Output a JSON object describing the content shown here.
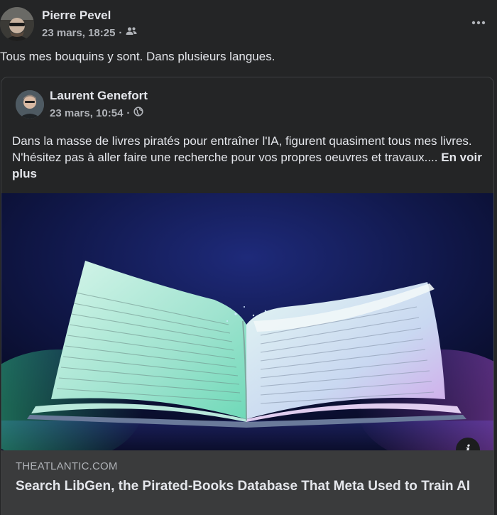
{
  "post": {
    "author": "Pierre Pevel",
    "timestamp": "23 mars, 18:25",
    "separator": "·",
    "audience_icon": "friends-icon",
    "more_icon": "more-options-icon",
    "text": "Tous mes bouquins y sont. Dans plusieurs langues."
  },
  "shared": {
    "author": "Laurent Genefort",
    "timestamp": "23 mars, 10:54",
    "separator": "·",
    "audience_icon": "globe-icon",
    "text": "Dans la masse de livres piratés pour entraîner l'IA, figurent quasiment tous mes livres. N'hésitez pas à aller faire une recherche pour vos propres oeuvres et travaux....",
    "see_more": "En voir plus"
  },
  "link": {
    "domain": "THEATLANTIC.COM",
    "title": "Search LibGen, the Pirated-Books Database That Meta Used to Train AI",
    "info_label": "i",
    "info_icon": "info-icon"
  },
  "colors": {
    "background": "#242526",
    "card_footer": "#3a3b3c",
    "text_primary": "#e4e6eb",
    "text_secondary": "#b0b3b8"
  }
}
